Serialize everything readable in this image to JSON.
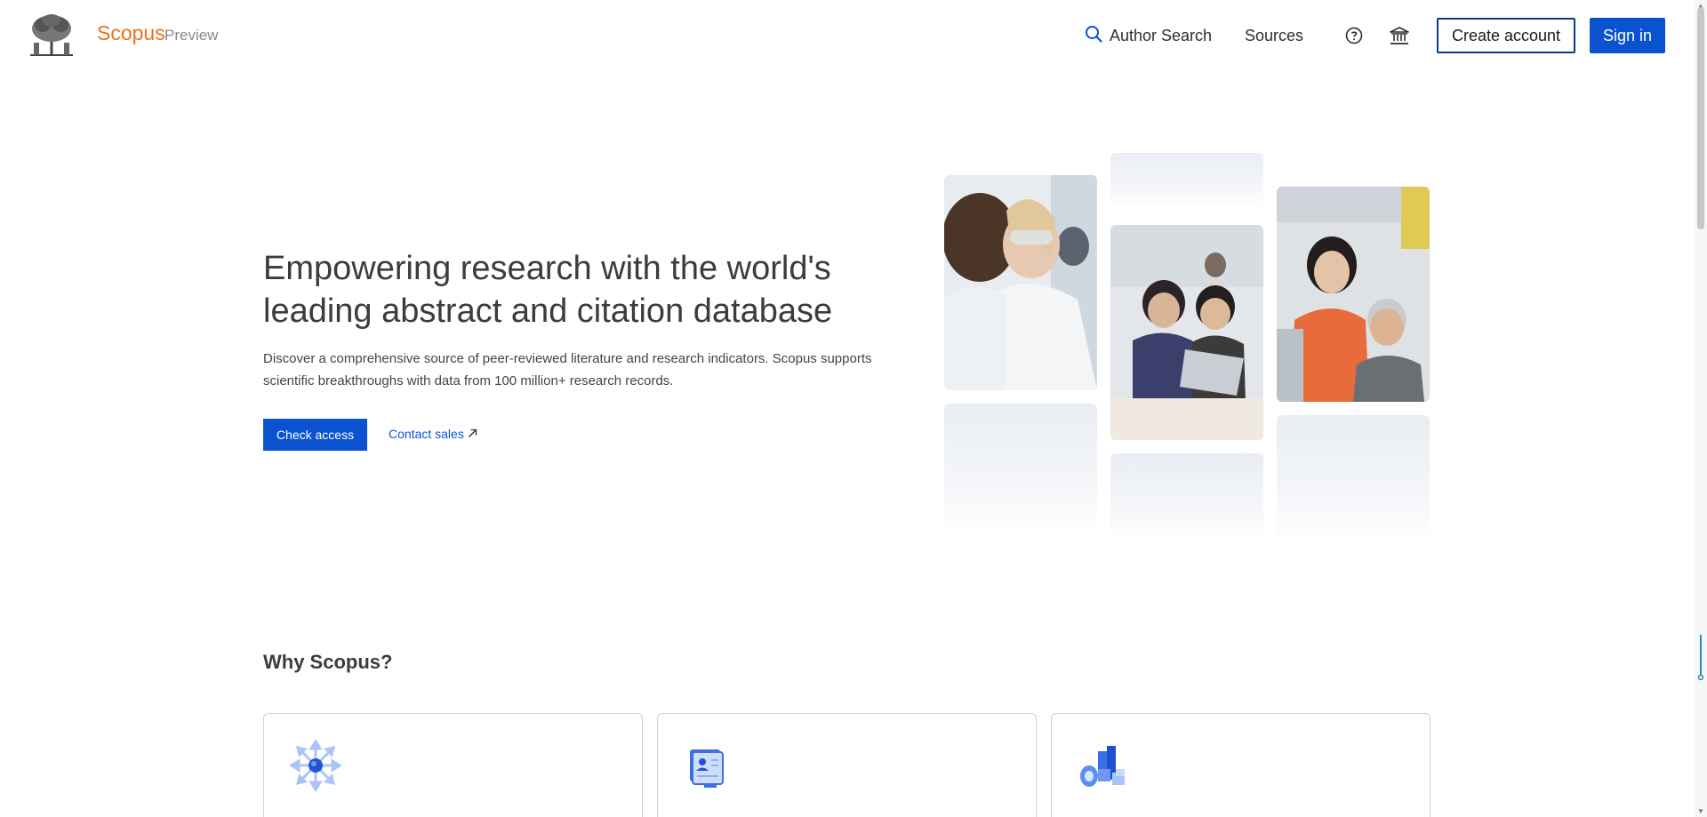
{
  "header": {
    "brand": "Scopus",
    "brand_sub": "Preview",
    "nav": {
      "author_search": "Author Search",
      "sources": "Sources"
    },
    "create_account": "Create account",
    "sign_in": "Sign in"
  },
  "hero": {
    "title": "Empowering research with the world's leading abstract and citation database",
    "description": "Discover a comprehensive source of peer-reviewed literature and research indicators. Scopus supports scientific breakthroughs with data from 100 million+ research records.",
    "check_access": "Check access",
    "contact_sales": "Contact sales"
  },
  "why": {
    "title": "Why Scopus?"
  },
  "colors": {
    "brand_orange": "#e9711c",
    "primary_blue": "#0b52d0",
    "outline_navy": "#0c3a8a"
  }
}
